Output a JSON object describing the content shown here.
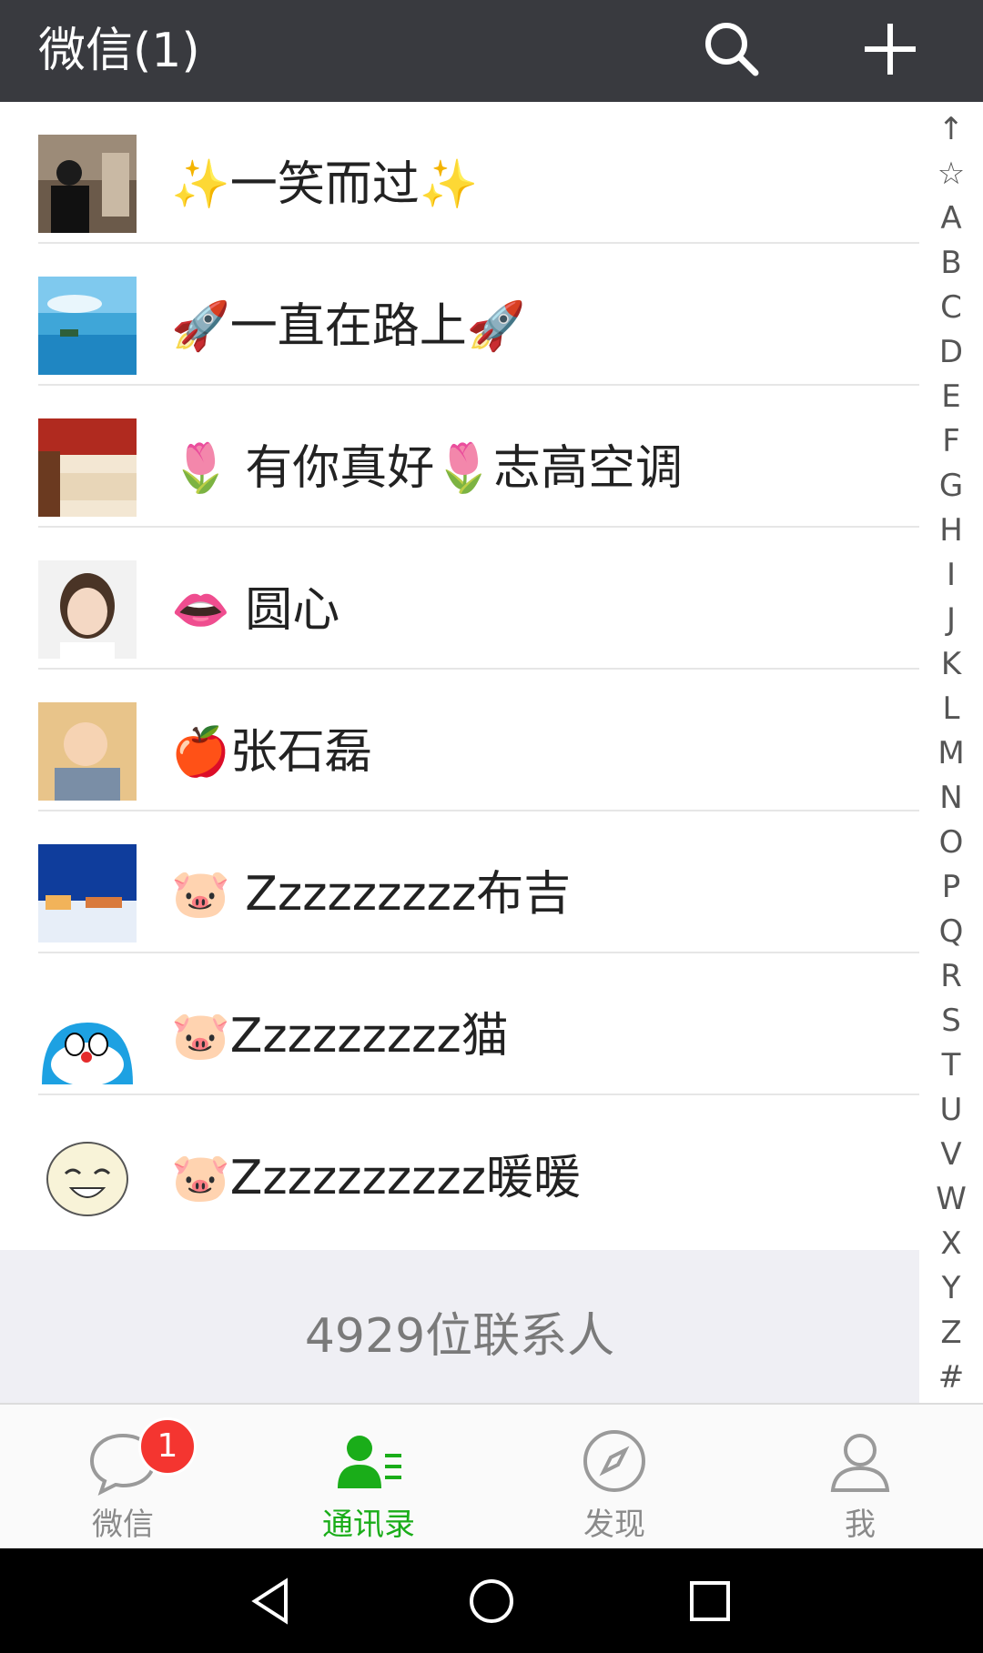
{
  "header": {
    "title": "微信(1)"
  },
  "contacts": [
    {
      "name": "✨一笑而过✨"
    },
    {
      "name": "🚀一直在路上🚀"
    },
    {
      "name": "🌷 有你真好🌷志高空调"
    },
    {
      "name": "👄 圆心"
    },
    {
      "name": "🍎张石磊"
    },
    {
      "name": "🐷 Zzzzzzzzz布吉"
    },
    {
      "name": "🐷Zzzzzzzzz猫"
    },
    {
      "name": "🐷Zzzzzzzzzz暖暖"
    }
  ],
  "contact_count": "4929位联系人",
  "index_bar": [
    "↑",
    "☆",
    "A",
    "B",
    "C",
    "D",
    "E",
    "F",
    "G",
    "H",
    "I",
    "J",
    "K",
    "L",
    "M",
    "N",
    "O",
    "P",
    "Q",
    "R",
    "S",
    "T",
    "U",
    "V",
    "W",
    "X",
    "Y",
    "Z",
    "#"
  ],
  "tabs": [
    {
      "label": "微信",
      "badge": "1",
      "icon": "chat-bubble-icon"
    },
    {
      "label": "通讯录",
      "icon": "contacts-icon"
    },
    {
      "label": "发现",
      "icon": "compass-icon"
    },
    {
      "label": "我",
      "icon": "person-icon"
    }
  ],
  "colors": {
    "topbar": "#393a3f",
    "accent_green": "#1aad19",
    "badge_red": "#f43530"
  }
}
